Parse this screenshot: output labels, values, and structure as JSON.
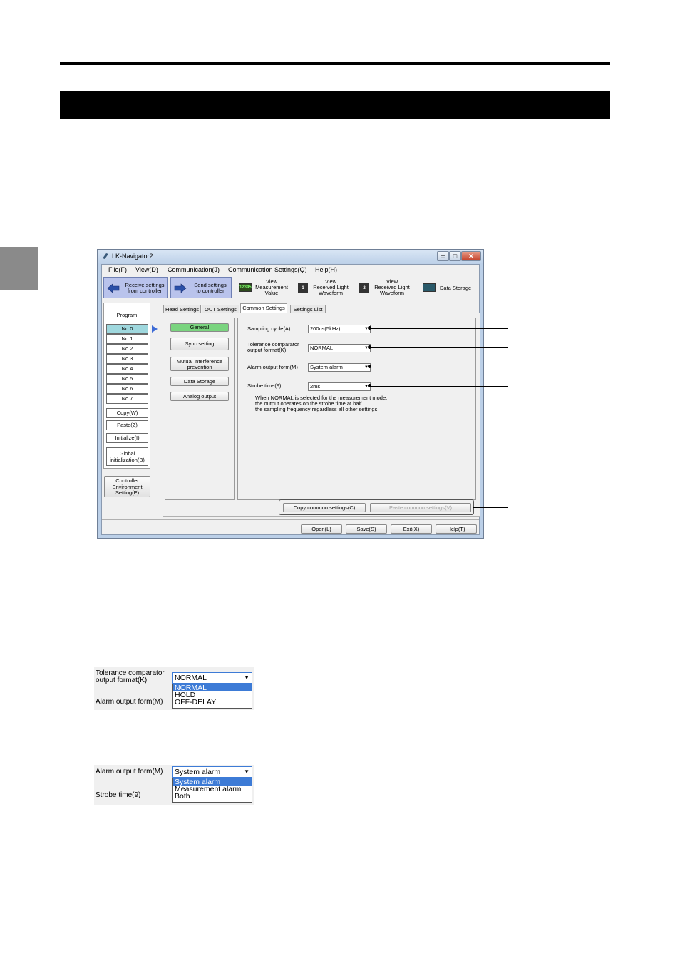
{
  "window": {
    "title": "LK-Navigator2",
    "min_glyph": "▭",
    "max_glyph": "□",
    "close_glyph": "✕"
  },
  "menu": [
    "File(F)",
    "View(D)",
    "Communication(J)",
    "Communication Settings(Q)",
    "Help(H)"
  ],
  "toolbar": {
    "receive": [
      "Receive settings",
      "from controller"
    ],
    "send": [
      "Send settings",
      "to controller"
    ],
    "view_measurement": [
      "View",
      "Measurement",
      "Value"
    ],
    "view_waveform1": [
      "View",
      "Received Light",
      "Waveform"
    ],
    "view_waveform2": [
      "View",
      "Received Light",
      "Waveform"
    ],
    "data_storage": "Data Storage",
    "measurement_icon_text": "12345",
    "waveform1_icon_text": "1",
    "waveform2_icon_text": "2"
  },
  "program": {
    "title": "Program",
    "items": [
      "No.0",
      "No.1",
      "No.2",
      "No.3",
      "No.4",
      "No.5",
      "No.6",
      "No.7"
    ],
    "copy": "Copy(W)",
    "paste": "Paste(Z)",
    "initialize": "Initialize(I)",
    "global_init": [
      "Global",
      "initialization(B)"
    ],
    "controller_env": [
      "Controller",
      "Environment",
      "Setting(E)"
    ]
  },
  "tabs": [
    "Head Settings",
    "OUT Settings",
    "Common Settings",
    "Settings List"
  ],
  "categories": [
    "General",
    "Sync setting",
    "Mutual interference prevention",
    "Data Storage",
    "Analog output"
  ],
  "settings": {
    "sampling_label": "Sampling cycle(A)",
    "sampling_value": "200us(5kHz)",
    "tolerance_label": [
      "Tolerance comparator",
      "output format(K)"
    ],
    "tolerance_value": "NORMAL",
    "alarm_label": "Alarm output form(M)",
    "alarm_value": "System alarm",
    "strobe_label": "Strobe time(9)",
    "strobe_value": "2ms",
    "note": [
      "When NORMAL is selected for the measurement mode,",
      "the output operates on the strobe time at half",
      "the sampling frequency regardless all other settings."
    ],
    "copy_common": "Copy common settings(C)",
    "paste_common": "Paste common settings(V)"
  },
  "footer_buttons": [
    "Open(L)",
    "Save(S)",
    "Exit(X)",
    "Help(T)"
  ],
  "dropdown1": {
    "label": [
      "Tolerance comparator",
      "output format(K)"
    ],
    "value": "NORMAL",
    "options": [
      "NORMAL",
      "HOLD",
      "OFF-DELAY"
    ],
    "next_label": "Alarm output form(M)"
  },
  "dropdown2": {
    "label": "Alarm output form(M)",
    "value": "System alarm",
    "options": [
      "System alarm",
      "Measurement alarm",
      "Both"
    ],
    "next_label": "Strobe time(9)"
  },
  "colors": {
    "selected_item": "#9fd8de",
    "selected_category": "#7ad47f",
    "selection_blue": "#3d7bd6",
    "toolbar_button": "#b9c3ec"
  }
}
